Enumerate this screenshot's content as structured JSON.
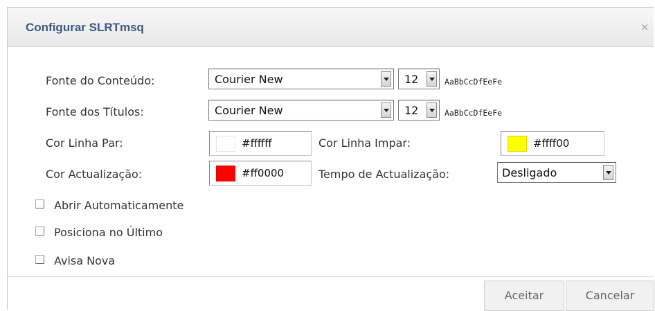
{
  "dialog": {
    "title": "Configurar SLRTmsq",
    "close_glyph": "×"
  },
  "fonts": {
    "content": {
      "label": "Fonte do Conteúdo:",
      "font": "Courier New",
      "size": "12",
      "sample": "AaBbCcDfEeFe"
    },
    "titles": {
      "label": "Fonte dos Títulos:",
      "font": "Courier New",
      "size": "12",
      "sample": "AaBbCcDfEeFe"
    }
  },
  "colors": {
    "even_row": {
      "label": "Cor Linha Par:",
      "value": "#ffffff",
      "swatch": "#ffffff"
    },
    "odd_row": {
      "label": "Cor Linha Impar:",
      "value": "#ffff00",
      "swatch": "#ffff00"
    },
    "update": {
      "label": "Cor Actualização:",
      "value": "#ff0000",
      "swatch": "#ff0000"
    }
  },
  "update_time": {
    "label": "Tempo de Actualização:",
    "value": "Desligado"
  },
  "options": [
    {
      "label": "Abrir Automaticamente",
      "checked": false
    },
    {
      "label": "Posiciona no Último",
      "checked": false
    },
    {
      "label": "Avisa Nova",
      "checked": false
    }
  ],
  "buttons": {
    "accept": "Aceitar",
    "cancel": "Cancelar"
  }
}
